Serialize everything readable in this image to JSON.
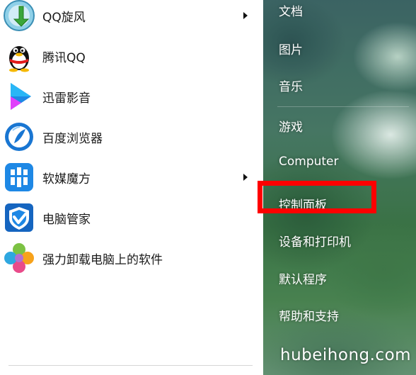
{
  "programs": [
    {
      "label": "QQ旋风",
      "icon": "qq-xuanfeng-icon",
      "has_submenu": true
    },
    {
      "label": "腾讯QQ",
      "icon": "qq-penguin-icon",
      "has_submenu": false
    },
    {
      "label": "迅雷影音",
      "icon": "xunlei-player-icon",
      "has_submenu": false
    },
    {
      "label": "百度浏览器",
      "icon": "baidu-browser-icon",
      "has_submenu": false
    },
    {
      "label": "软媒魔方",
      "icon": "ruanmei-mofang-icon",
      "has_submenu": true
    },
    {
      "label": "电脑管家",
      "icon": "pc-manager-icon",
      "has_submenu": false
    },
    {
      "label": "强力卸载电脑上的软件",
      "icon": "uninstaller-icon",
      "has_submenu": false
    }
  ],
  "places": [
    {
      "label": "文档"
    },
    {
      "label": "图片"
    },
    {
      "label": "音乐"
    },
    {
      "label": "游戏"
    },
    {
      "label": "Computer"
    },
    {
      "label": "控制面板"
    },
    {
      "label": "设备和打印机"
    },
    {
      "label": "默认程序"
    },
    {
      "label": "帮助和支持"
    }
  ],
  "watermark": "hubeihong.com",
  "colors": {
    "highlight": "#ff0000",
    "place_text": "#ffffff",
    "program_text": "#1a1a1a"
  }
}
